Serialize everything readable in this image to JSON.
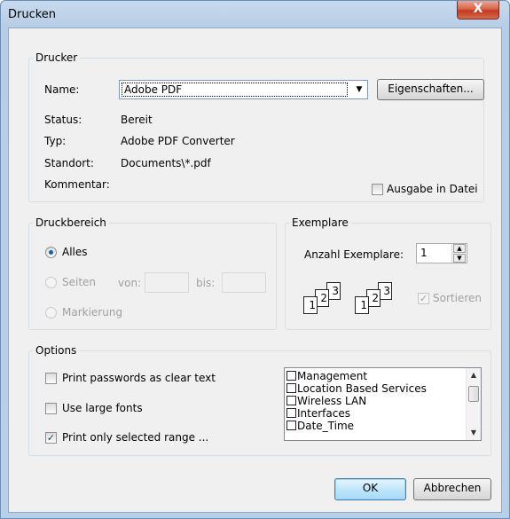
{
  "window": {
    "title": "Drucken",
    "close_glyph": "X"
  },
  "printer": {
    "group_label": "Drucker",
    "name_label": "Name:",
    "name_value": "Adobe PDF",
    "properties_button": "Eigenschaften...",
    "status_label": "Status:",
    "status_value": "Bereit",
    "type_label": "Typ:",
    "type_value": "Adobe PDF Converter",
    "location_label": "Standort:",
    "location_value": "Documents\\*.pdf",
    "comment_label": "Kommentar:",
    "output_to_file_label": "Ausgabe in Datei",
    "output_to_file_checked": false
  },
  "range": {
    "group_label": "Druckbereich",
    "all_label": "Alles",
    "all_selected": true,
    "pages_label": "Seiten",
    "from_label": "von:",
    "to_label": "bis:",
    "selection_label": "Markierung"
  },
  "copies": {
    "group_label": "Exemplare",
    "count_label": "Anzahl Exemplare:",
    "count_value": "1",
    "collate_label": "Sortieren",
    "collate_checked": true,
    "collate_icon_pages": [
      "1",
      "2",
      "3"
    ]
  },
  "options": {
    "group_label": "Options",
    "print_passwords_label": "Print passwords as clear text",
    "print_passwords_checked": false,
    "large_fonts_label": "Use large fonts",
    "large_fonts_checked": false,
    "selected_range_label": "Print only selected range ...",
    "selected_range_checked": true,
    "sections": [
      "Management",
      "Location Based Services",
      "Wireless LAN",
      "Interfaces",
      "Date_Time"
    ]
  },
  "footer": {
    "ok_button": "OK",
    "cancel_button": "Abbrechen"
  },
  "colors": {
    "title_bar": "#b9cfe7",
    "close_button": "#c8442a",
    "dialog_bg": "#f0f0f0",
    "ok_highlight": "#bee6fd"
  },
  "icons": [
    "close-icon",
    "dropdown-arrow-icon",
    "spin-up-icon",
    "spin-down-icon",
    "collate-icon",
    "scroll-up-icon",
    "scroll-down-icon",
    "check-icon"
  ]
}
